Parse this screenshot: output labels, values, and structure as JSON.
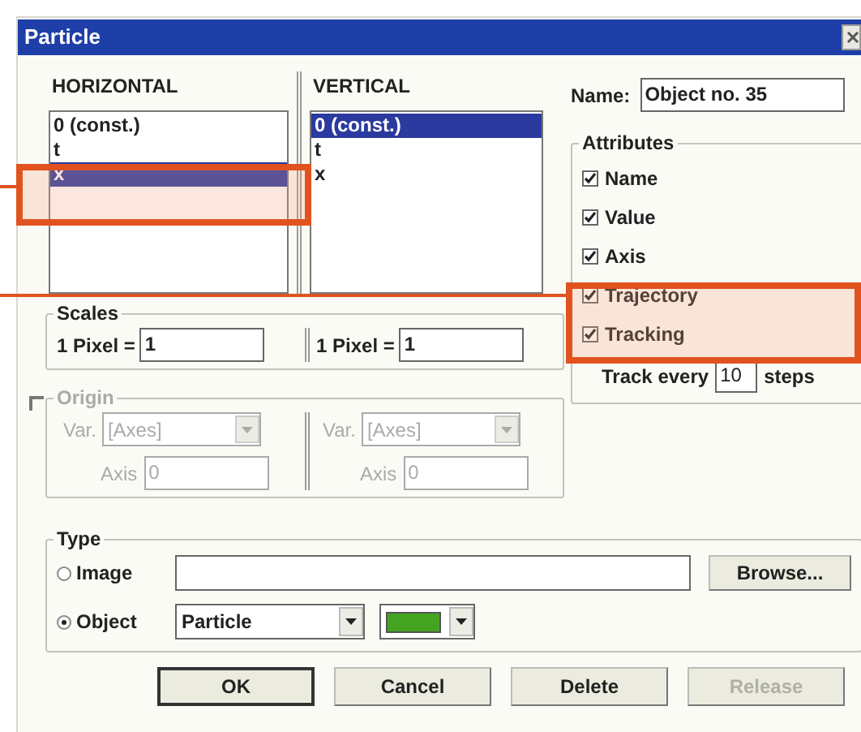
{
  "window": {
    "title": "Particle"
  },
  "horizontal": {
    "heading": "HORIZONTAL",
    "items": [
      {
        "label": "0 (const.)",
        "selected": false
      },
      {
        "label": "t",
        "selected": false
      },
      {
        "label": "x",
        "selected": true
      }
    ]
  },
  "vertical": {
    "heading": "VERTICAL",
    "items": [
      {
        "label": "0 (const.)",
        "selected": true
      },
      {
        "label": "t",
        "selected": false
      },
      {
        "label": "x",
        "selected": false
      }
    ]
  },
  "name": {
    "label": "Name:",
    "value": "Object no. 35"
  },
  "attributes": {
    "title": "Attributes",
    "items": [
      {
        "label": "Name",
        "checked": true
      },
      {
        "label": "Value",
        "checked": true
      },
      {
        "label": "Axis",
        "checked": true
      },
      {
        "label": "Trajectory",
        "checked": true
      },
      {
        "label": "Tracking",
        "checked": true
      }
    ],
    "track_label": "Track every",
    "track_value": "10",
    "track_unit": "steps"
  },
  "scales": {
    "title": "Scales",
    "fields": [
      {
        "label": "1 Pixel =",
        "value": "1"
      },
      {
        "label": "1 Pixel =",
        "value": "1"
      }
    ]
  },
  "origin": {
    "title": "Origin",
    "checked": false,
    "disabled": true,
    "columns": [
      {
        "var_label": "Var.",
        "var_value": "[Axes]",
        "axis_label": "Axis",
        "axis_value": "0"
      },
      {
        "var_label": "Var.",
        "var_value": "[Axes]",
        "axis_label": "Axis",
        "axis_value": "0"
      }
    ]
  },
  "type": {
    "title": "Type",
    "options": [
      {
        "label": "Image",
        "selected": false
      },
      {
        "label": "Object",
        "selected": true
      }
    ],
    "browse_button": "Browse...",
    "object_value": "Particle",
    "color": "#44a422"
  },
  "buttons": [
    {
      "label": "OK",
      "disabled": false,
      "default": true
    },
    {
      "label": "Cancel",
      "disabled": false,
      "default": false
    },
    {
      "label": "Delete",
      "disabled": false,
      "default": false
    },
    {
      "label": "Release",
      "disabled": true,
      "default": false
    }
  ]
}
